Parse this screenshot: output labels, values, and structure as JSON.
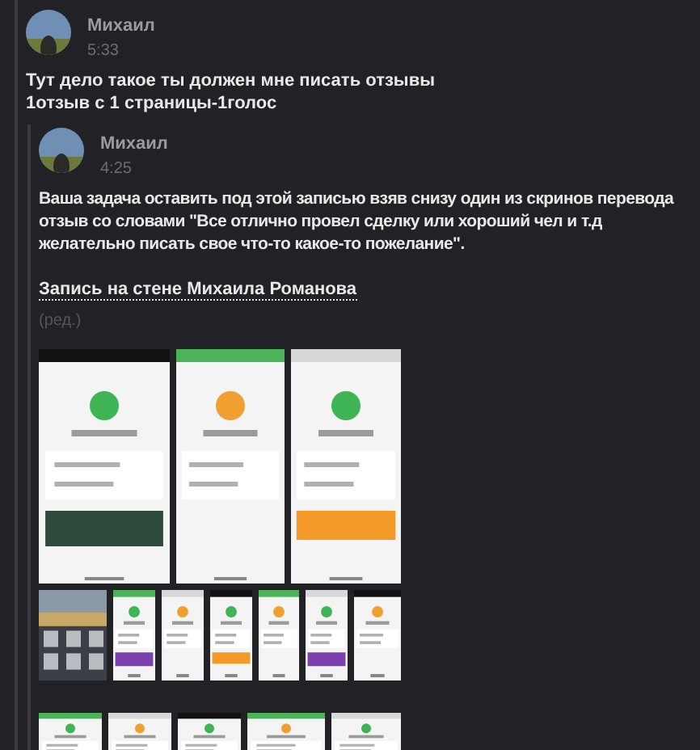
{
  "message": {
    "author": "Михаил",
    "time": "5:33",
    "lines": [
      "Тут дело такое ты должен мне писать отзывы",
      "1отзыв с 1 страницы-1голос"
    ],
    "forwarded": {
      "author": "Михаил",
      "time": "4:25",
      "text": "Ваша задача оставить под этой записью взяв снизу один из скринов перевода отзыв со словами \"Все отлично провел сделку или хороший чел и т.д желательно писать свое что-то какое-то пожелание\".",
      "link": "Запись на стене Михаила Романова",
      "edited": "(ред.)"
    }
  }
}
